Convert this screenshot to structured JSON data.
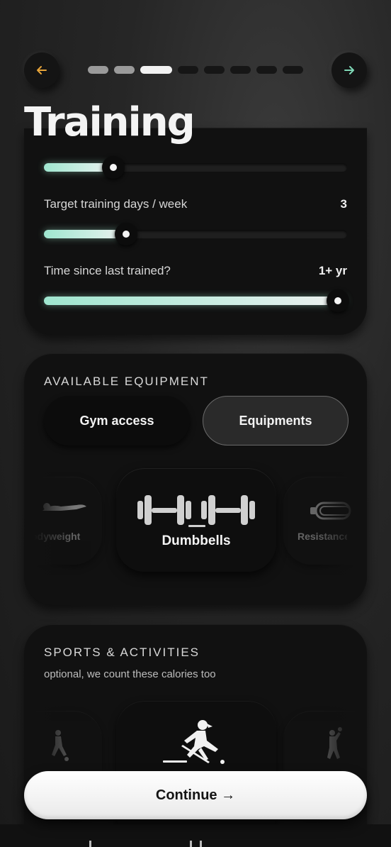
{
  "header": {
    "title": "Training",
    "back_icon": "arrow-left-icon",
    "next_icon": "arrow-right-icon",
    "back_color": "#e8a53a",
    "next_color": "#7fd8b6",
    "progress_steps": [
      {
        "state": "done"
      },
      {
        "state": "done"
      },
      {
        "state": "active"
      },
      {
        "state": "todo"
      },
      {
        "state": "todo"
      },
      {
        "state": "todo"
      },
      {
        "state": "todo"
      },
      {
        "state": "todo"
      }
    ]
  },
  "training": {
    "sliders": [
      {
        "label": "",
        "value": "",
        "fill_fraction": 0.23
      },
      {
        "label": "Target training days / week",
        "value": "3",
        "fill_fraction": 0.27
      },
      {
        "label": "Time since last trained?",
        "value": "1+ yr",
        "fill_fraction": 1.0
      }
    ]
  },
  "equipment": {
    "heading": "AVAILABLE EQUIPMENT",
    "toggles": [
      {
        "label": "Gym access",
        "selected": false
      },
      {
        "label": "Equipments",
        "selected": true
      }
    ],
    "items": {
      "left": {
        "label": "Bodyweight",
        "icon": "bodyweight-icon"
      },
      "center": {
        "label": "Dumbbells",
        "icon": "dumbbells-icon"
      },
      "right": {
        "label": "Resistance",
        "icon": "resistance-band-icon"
      }
    }
  },
  "sports": {
    "heading": "SPORTS & ACTIVITIES",
    "subtitle": "optional, we count these calories too",
    "items": {
      "left": {
        "icon": "soccer-player-icon"
      },
      "center": {
        "icon": "field-hockey-player-icon"
      },
      "right": {
        "icon": "handball-player-icon"
      }
    }
  },
  "footer": {
    "continue_label": "Continue →"
  },
  "colors": {
    "accent": "#9fe6cf",
    "card": "#111111"
  }
}
